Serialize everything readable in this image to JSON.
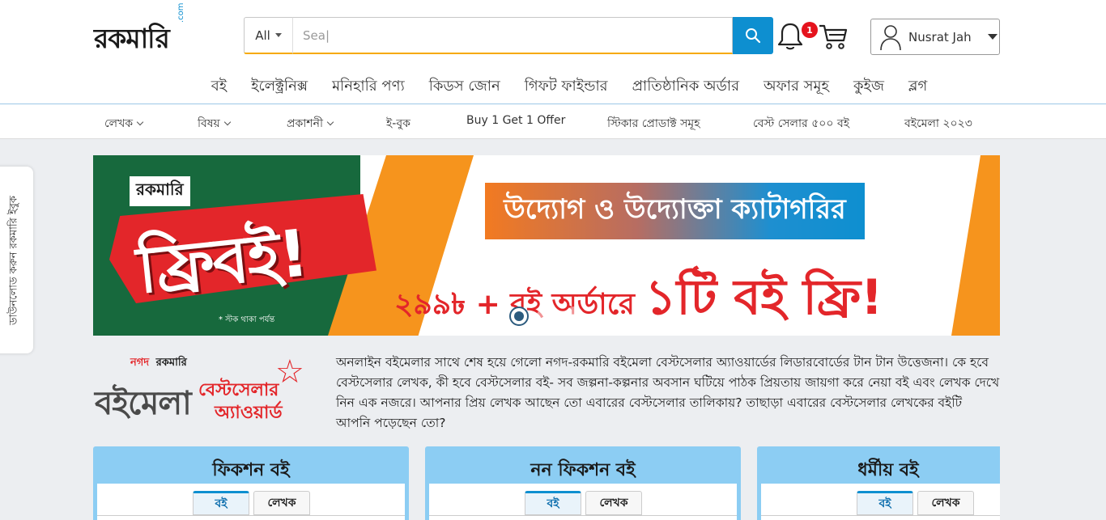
{
  "header": {
    "logo": "রকমারি",
    "logo_suffix": ".com",
    "search": {
      "category": "All",
      "value": "Sea|"
    },
    "notification_count": "1",
    "user_name": "Nusrat Jah"
  },
  "main_nav": [
    "বই",
    "ইলেক্ট্রনিক্স",
    "মনিহারি পণ্য",
    "কিডস জোন",
    "গিফট ফাইন্ডার",
    "প্রাতিষ্ঠানিক অর্ডার",
    "অফার সমূহ",
    "কুইজ",
    "ব্লগ"
  ],
  "sub_nav": {
    "writer": "লেখক",
    "subject": "বিষয়",
    "publisher": "প্রকাশনী",
    "ebook": "ই-বুক",
    "bogo": "Buy 1 Get 1 Offer",
    "sticker": "স্টিকার প্রোডাক্ট সমূহ",
    "bestseller": "বেস্ট সেলার ৫০০ বই",
    "boimela": "বইমেলা ২০২৩"
  },
  "side_tab": "ডাউনলোড করুন রকমারি ইবুক",
  "banner": {
    "logo": "রকমারি",
    "free": "ফ্রিবই!",
    "stock_note": "* স্টক থাকা পর্যন্ত",
    "category": "উদ্যোগ ও উদ্যোক্তা ক্যাটাগরির",
    "offer_prefix": "২৯৯৳ + বই অর্ডারে",
    "offer_big": "১টি বই ফ্রি!",
    "slide_count": 3,
    "active_slide": 1
  },
  "award": {
    "partner1": "নগদ",
    "partner2": "রকমারি",
    "title": "বইমেলা",
    "sub1": "বেস্টসেলার",
    "sub2": "অ্যাওয়ার্ড",
    "text": "অনলাইন বইমেলার সাথে শেষ হয়ে গেলো নগদ-রকমারি বইমেলা বেস্টসেলার অ্যাওয়ার্ডের লিডারবোর্ডের টান টান উত্তেজনা। কে হবে বেস্টসেলার লেখক, কী হবে বেস্টসেলার বই- সব জল্পনা-কল্পনার অবসান ঘটিয়ে পাঠক প্রিয়তায় জায়গা করে নেয়া বই এবং লেখক দেখে নিন এক নজরে। আপনার প্রিয় লেখক আছেন তো এবারের বেস্টসেলার তালিকায়? তাছাড়া এবারের বেস্টসেলার লেখকের বইটি আপনি পড়েছেন তো?"
  },
  "cards": [
    {
      "title": "ফিকশন বই",
      "tab_book": "বই",
      "tab_writer": "লেখক"
    },
    {
      "title": "নন ফিকশন বই",
      "tab_book": "বই",
      "tab_writer": "লেখক"
    },
    {
      "title": "ধর্মীয় বই",
      "tab_book": "বই",
      "tab_writer": "লেখক"
    }
  ],
  "colors": {
    "accent_blue": "#0e8fd0",
    "banner_red": "#e3262a",
    "banner_green": "#17693d",
    "card_blue": "#8ccdf3"
  }
}
